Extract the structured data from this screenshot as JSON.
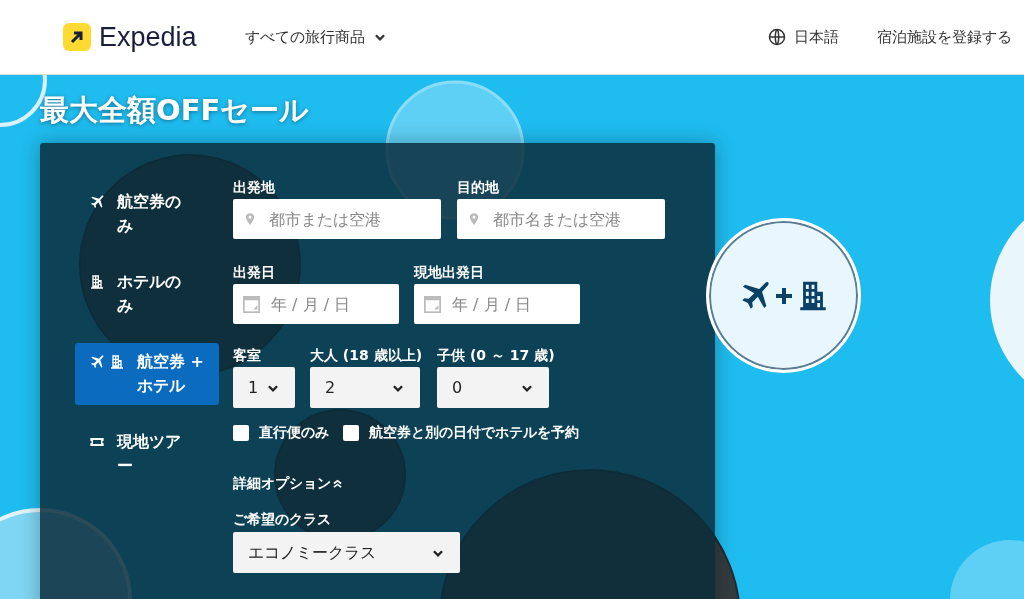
{
  "header": {
    "logo": "Expedia",
    "nav": "すべての旅行商品",
    "language": "日本語",
    "link": "宿泊施設を登録する"
  },
  "hero": {
    "title": "最大全額OFFセール"
  },
  "tabs": [
    {
      "kind": "flight",
      "label": "航空券のみ",
      "selected": false
    },
    {
      "kind": "hotel",
      "label": "ホテルのみ",
      "selected": false
    },
    {
      "kind": "package",
      "label": "航空券 + ホテル",
      "selected": true
    },
    {
      "kind": "activity",
      "label": "現地ツアー",
      "selected": false
    }
  ],
  "places": [
    {
      "label": "出発地",
      "placeholder": "都市または空港"
    },
    {
      "label": "目的地",
      "placeholder": "都市名または空港"
    }
  ],
  "dates": [
    {
      "label": "出発日",
      "placeholder": "年 / 月 / 日"
    },
    {
      "label": "現地出発日",
      "placeholder": "年 / 月 / 日"
    }
  ],
  "travellers": [
    {
      "label": "客室",
      "value": "1"
    },
    {
      "label": "大人 (18 歳以上)",
      "value": "2"
    },
    {
      "label": "子供 (0 ～ 17 歳)",
      "value": "0"
    }
  ],
  "options": [
    {
      "label": "直行便のみ",
      "checked": false
    },
    {
      "label": "航空券と別の日付でホテルを予約",
      "checked": false
    }
  ],
  "advanced": {
    "label": "詳細オプション",
    "expanded": true
  },
  "cabin": {
    "label": "ご希望のクラス",
    "value": "エコノミークラス"
  }
}
